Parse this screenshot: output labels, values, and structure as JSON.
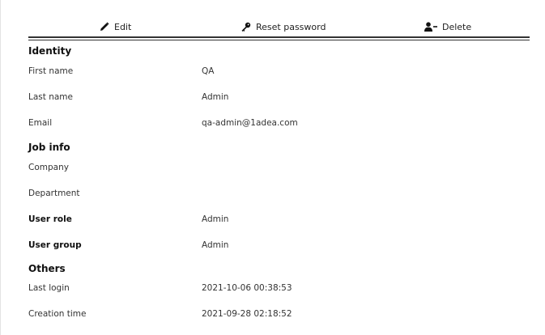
{
  "toolbar": {
    "edit_label": "Edit",
    "reset_password_label": "Reset password",
    "delete_label": "Delete",
    "edit_icon": "pencil-icon",
    "reset_icon": "key-icon",
    "delete_icon": "user-minus-icon"
  },
  "sections": {
    "identity": "Identity",
    "job_info": "Job info",
    "others": "Others"
  },
  "fields": {
    "first_name": {
      "label": "First name",
      "value": "QA"
    },
    "last_name": {
      "label": "Last name",
      "value": "Admin"
    },
    "email": {
      "label": "Email",
      "value": "qa-admin@1adea.com"
    },
    "company": {
      "label": "Company",
      "value": ""
    },
    "department": {
      "label": "Department",
      "value": ""
    },
    "user_role": {
      "label": "User role",
      "value": "Admin"
    },
    "user_group": {
      "label": "User group",
      "value": "Admin"
    },
    "last_login": {
      "label": "Last login",
      "value": "2021-10-06 00:38:53"
    },
    "creation_time": {
      "label": "Creation time",
      "value": "2021-09-28 02:18:52"
    }
  }
}
